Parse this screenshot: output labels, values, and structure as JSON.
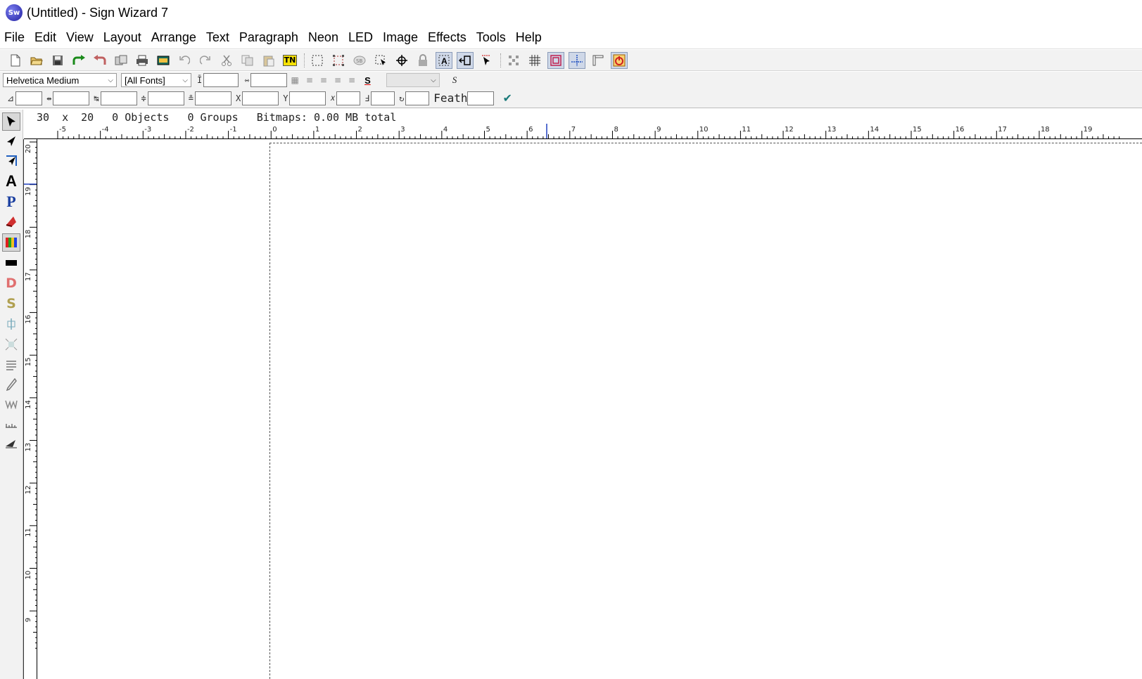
{
  "window": {
    "title": "(Untitled) - Sign Wizard 7",
    "logo_text": "Sw"
  },
  "menubar": {
    "items": [
      "File",
      "Edit",
      "View",
      "Layout",
      "Arrange",
      "Text",
      "Paragraph",
      "Neon",
      "LED",
      "Image",
      "Effects",
      "Tools",
      "Help"
    ]
  },
  "toolbar": {
    "tn_label": "TN",
    "buttons": [
      "new-document-icon",
      "open-folder-icon",
      "save-icon",
      "redo-arrow-icon",
      "undo-arrow-icon",
      "import-icon",
      "print-icon",
      "film-icon",
      "undo-icon",
      "redo-icon",
      "cut-icon",
      "copy-icon",
      "paste-icon",
      "tn-icon",
      "select-box-icon",
      "dashed-box-icon",
      "sb-icon",
      "node-select-icon",
      "crosshair-icon",
      "lock-icon",
      "text-frame-icon",
      "frame-arrow-icon",
      "cursor-icon",
      "dots-icon",
      "grid-icon",
      "page-frame-icon",
      "guides-icon",
      "ruler-toggle-icon",
      "stop-icon"
    ]
  },
  "format_bar": {
    "font_name": "Helvetica Medium",
    "font_filter": "[All Fonts]",
    "height_value": "",
    "width_value": "",
    "style_select": "",
    "feather_label": "Feath",
    "feather_value": "",
    "x_label": "X",
    "y_label": "Y",
    "x_value": "",
    "y_value": ""
  },
  "status": {
    "width": "30",
    "x_sep": "x",
    "height": "20",
    "objects": "0 Objects",
    "groups": "0 Groups",
    "bitmaps": "Bitmaps: 0.00 MB total"
  },
  "ruler": {
    "horizontal": [
      "-5",
      "-4",
      "-3",
      "-2",
      "-1",
      "0",
      "1",
      "2",
      "3",
      "4",
      "5",
      "6",
      "7",
      "8",
      "9",
      "10",
      "11",
      "12",
      "13",
      "14",
      "15",
      "16",
      "17",
      "18",
      "19"
    ],
    "vertical": [
      "20",
      "19",
      "18",
      "17",
      "16",
      "15",
      "14",
      "13",
      "12",
      "11",
      "10",
      "9"
    ]
  },
  "tools": [
    "select-arrow-icon",
    "node-edit-icon",
    "transform-icon",
    "text-tool-icon",
    "paragraph-tool-icon",
    "paint-icon",
    "color-palette-icon",
    "rectangle-fill-icon",
    "d-icon",
    "s-icon",
    "align-icon",
    "distribute-icon",
    "lines-icon",
    "pen-icon",
    "weld-icon",
    "measure-icon",
    "knife-icon"
  ],
  "colors": {
    "accent": "#3b3bb8",
    "toolbar_bg": "#f2f2f2",
    "canvas_bg": "#ffffff"
  }
}
